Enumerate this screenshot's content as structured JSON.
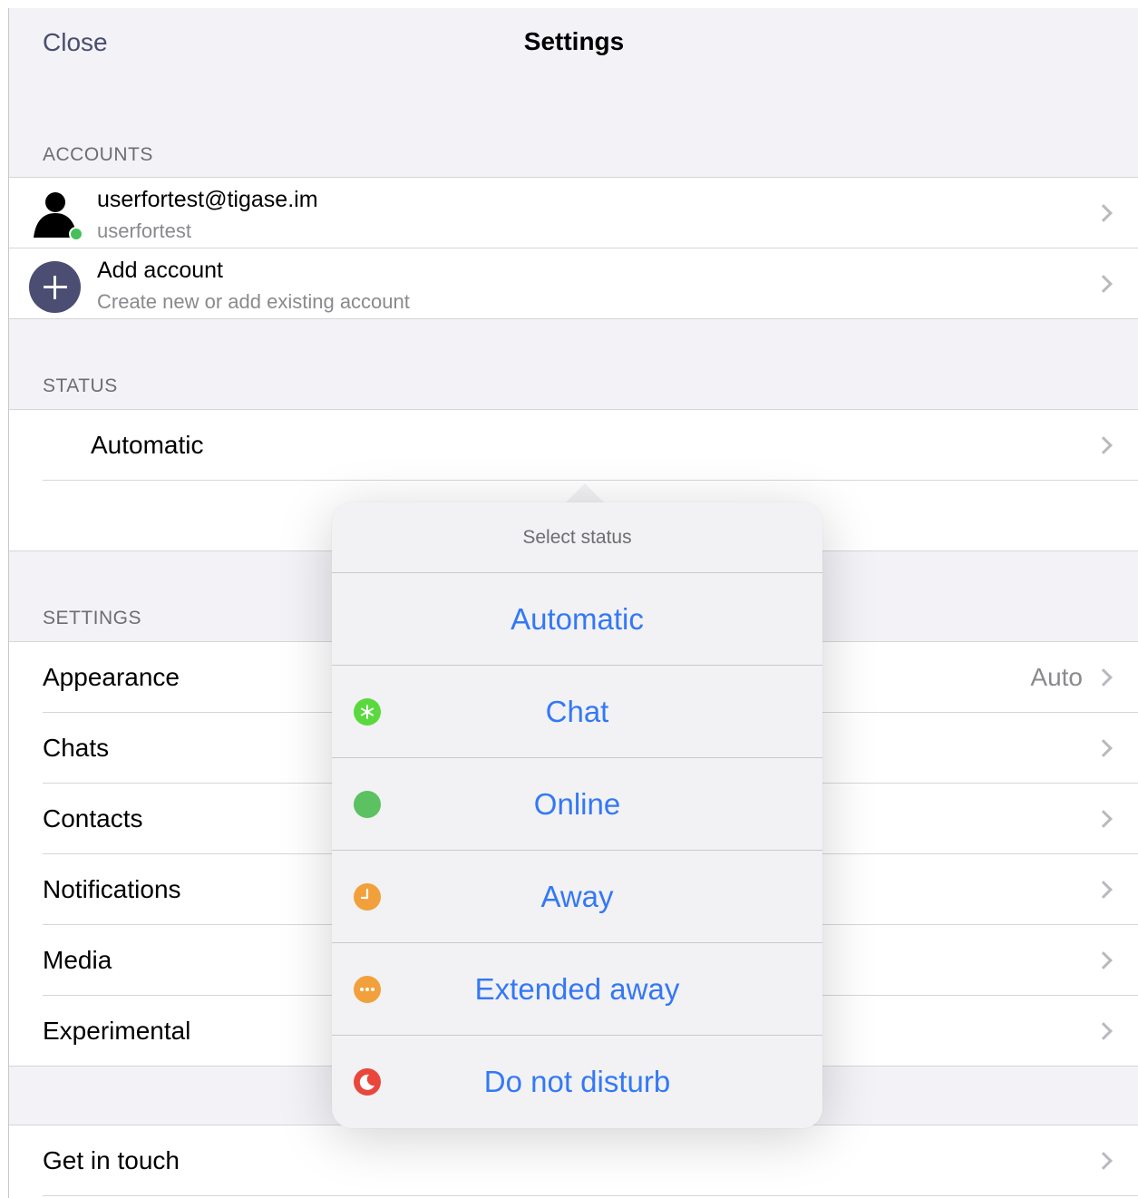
{
  "header": {
    "close_label": "Close",
    "title": "Settings"
  },
  "accounts": {
    "section_label": "ACCOUNTS",
    "items": [
      {
        "title": "userfortest@tigase.im",
        "subtitle": "userfortest",
        "presence_color": "#46c15a"
      },
      {
        "title": "Add account",
        "subtitle": "Create new or add existing account"
      }
    ]
  },
  "status": {
    "section_label": "STATUS",
    "value": "Automatic"
  },
  "settings": {
    "section_label": "SETTINGS",
    "items": [
      {
        "label": "Appearance",
        "value": "Auto"
      },
      {
        "label": "Chats"
      },
      {
        "label": "Contacts"
      },
      {
        "label": "Notifications"
      },
      {
        "label": "Media"
      },
      {
        "label": "Experimental"
      }
    ]
  },
  "support": {
    "items": [
      {
        "label": "Get in touch"
      }
    ]
  },
  "popover": {
    "title": "Select status",
    "options": [
      {
        "label": "Automatic",
        "icon": "none"
      },
      {
        "label": "Chat",
        "icon": "chat-status-icon",
        "color": "#5ad93f"
      },
      {
        "label": "Online",
        "icon": "online-status-icon",
        "color": "#5cc160"
      },
      {
        "label": "Away",
        "icon": "away-status-icon",
        "color": "#f2a03b"
      },
      {
        "label": "Extended away",
        "icon": "extended-away-status-icon",
        "color": "#f2a03b"
      },
      {
        "label": "Do not disturb",
        "icon": "do-not-disturb-status-icon",
        "color": "#e9473c"
      }
    ]
  },
  "colors": {
    "accent": "#3478f6",
    "nav_text": "#4a4d6e",
    "background": "#f2f2f7"
  }
}
